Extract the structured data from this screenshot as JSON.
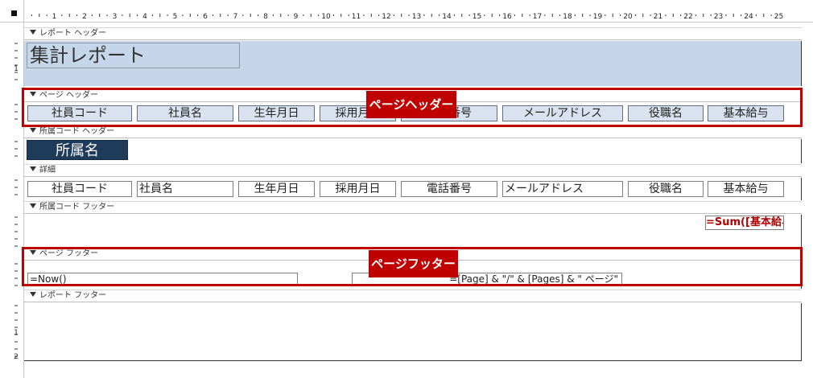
{
  "ruler": {
    "marks": [
      "1",
      "2",
      "3",
      "4",
      "5",
      "6",
      "7",
      "8",
      "9",
      "10",
      "11",
      "12",
      "13",
      "14",
      "15",
      "16",
      "17",
      "18",
      "19",
      "20",
      "21",
      "22",
      "23",
      "24",
      "25"
    ],
    "vmarks": [
      "1",
      "2"
    ]
  },
  "sections": {
    "report_header": "レポート ヘッダー",
    "page_header": "ページ ヘッダー",
    "group_header": "所属コード ヘッダー",
    "detail": "詳細",
    "group_footer": "所属コード フッター",
    "page_footer": "ページ フッター",
    "report_footer": "レポート フッター"
  },
  "report_title": "集計レポート",
  "column_headers": [
    "社員コード",
    "社員名",
    "生年月日",
    "採用月日",
    "電話番号",
    "メールアドレス",
    "役職名",
    "基本給与"
  ],
  "group_label": "所属名",
  "detail_fields": [
    "社員コード",
    "社員名",
    "生年月日",
    "採用月日",
    "電話番号",
    "メールアドレス",
    "役職名",
    "基本給与"
  ],
  "group_footer_sum": "=Sum([基本給与",
  "page_footer_fields": {
    "now": "=Now()",
    "pages": "=[Page] & \"/\" & [Pages] & \" ページ\""
  },
  "callouts": {
    "page_header": "ページヘッダー",
    "page_footer": "ページフッター"
  },
  "colors": {
    "callout": "#c00000",
    "header_band": "#c5d6ea",
    "group_label_bg": "#1f3b5a",
    "sum_text": "#b00000"
  }
}
